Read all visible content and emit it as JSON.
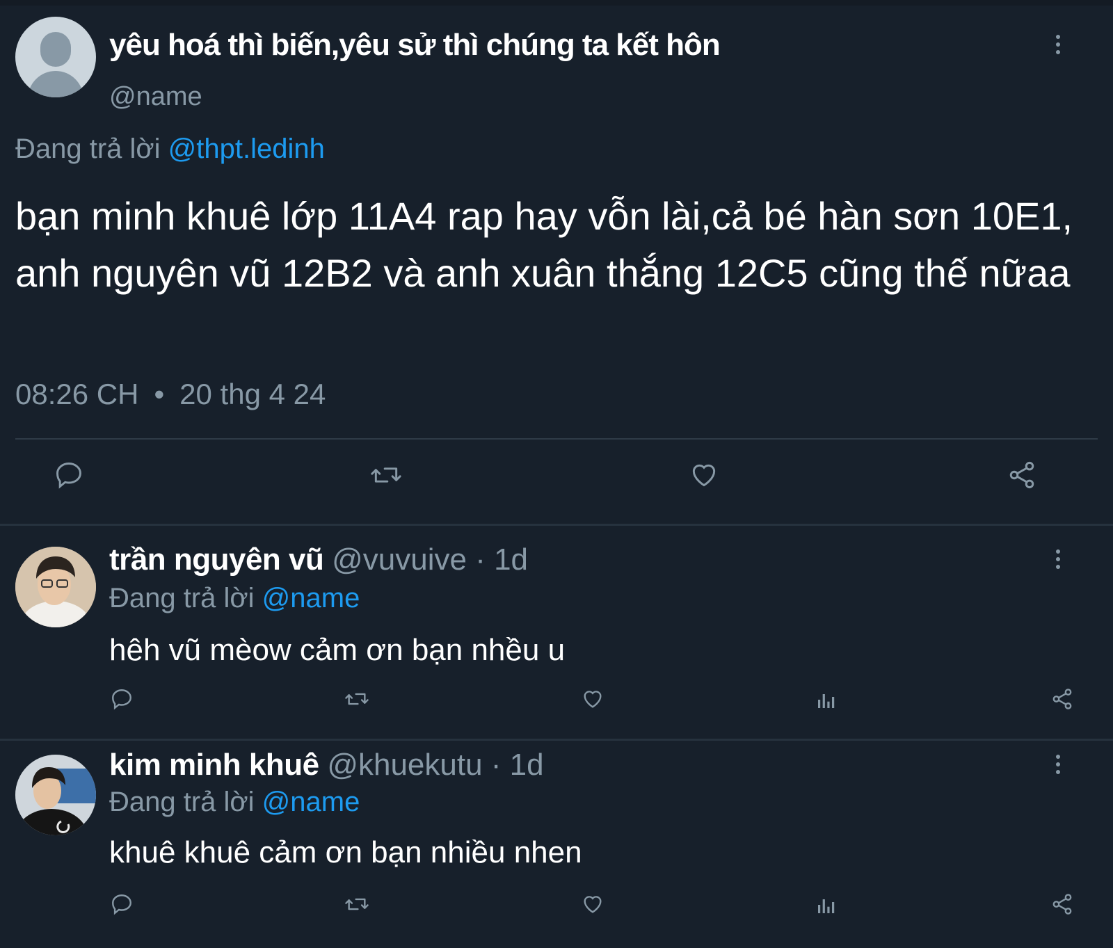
{
  "main_tweet": {
    "display_name": "yêu hoá thì biến,yêu sử thì chúng ta kết hôn",
    "handle": "@name",
    "reply_prefix": "Đang trả lời",
    "reply_target": "@thpt.ledinh",
    "text": "bạn minh khuê lớp 11A4 rap hay vỗn lài,cả bé hàn sơn 10E1, anh nguyên vũ 12B2 và anh xuân thắng 12C5 cũng thế nữaa",
    "time": "08:26 CH",
    "separator": "•",
    "date": "20 thg 4 24",
    "actions": [
      "reply-icon",
      "retweet-icon",
      "like-icon",
      "share-icon"
    ]
  },
  "replies": [
    {
      "display_name": "trần nguyên vũ",
      "handle_time": "@vuvuive · 1d",
      "reply_prefix": "Đang trả lời",
      "reply_target": "@name",
      "text": "hêh vũ mèow cảm ơn bạn nhều u",
      "actions": [
        "reply-icon",
        "retweet-icon",
        "like-icon",
        "views-icon",
        "share-icon"
      ]
    },
    {
      "display_name": "kim minh khuê",
      "handle_time": "@khuekutu · 1d",
      "reply_prefix": "Đang trả lời",
      "reply_target": "@name",
      "text": "khuê khuê cảm ơn bạn nhiều nhen",
      "actions": [
        "reply-icon",
        "retweet-icon",
        "like-icon",
        "views-icon",
        "share-icon"
      ]
    }
  ],
  "colors": {
    "background": "#17202b",
    "muted": "#8899a6",
    "link": "#1d9bf0",
    "divider": "#2f3b47"
  }
}
